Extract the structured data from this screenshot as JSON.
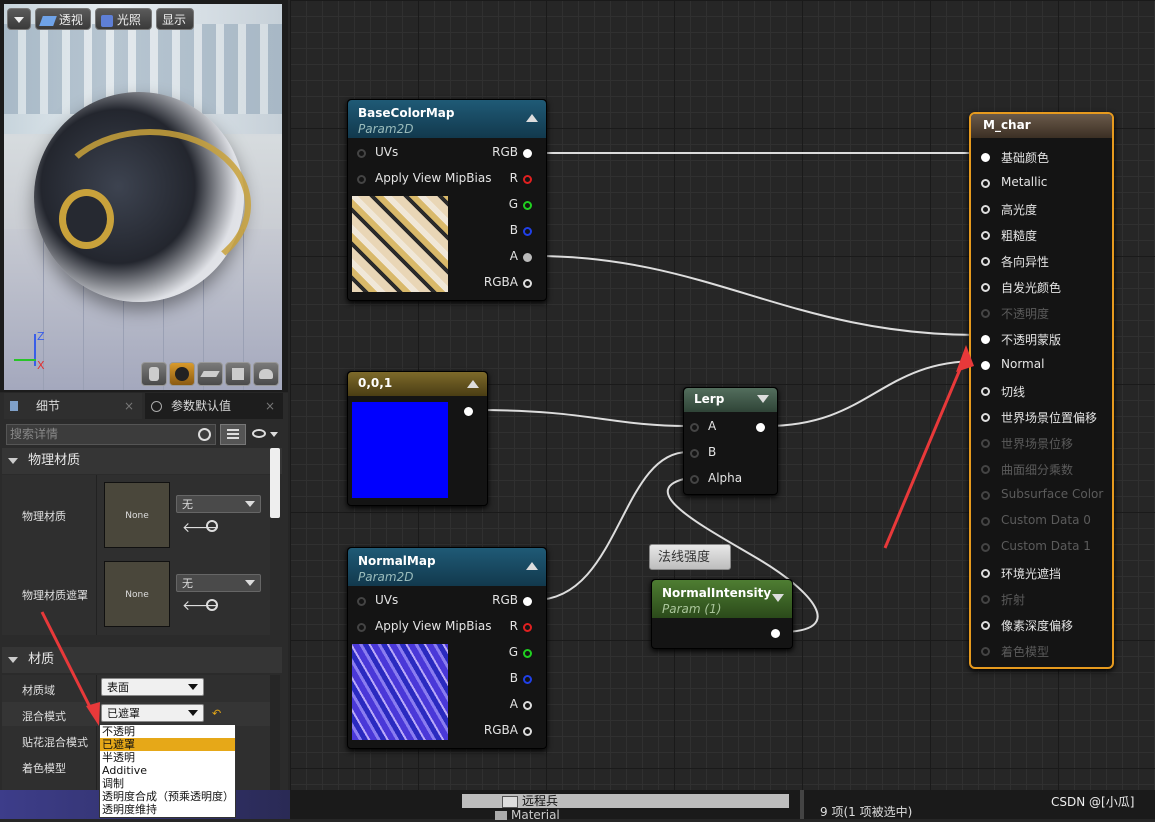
{
  "viewport": {
    "perspective_label": "透视",
    "lit_label": "光照",
    "show_label": "显示"
  },
  "details": {
    "tab_details": "细节",
    "tab_params": "参数默认值",
    "search_placeholder": "搜索详情",
    "physical_section": "物理材质",
    "phys_mat_label": "物理材质",
    "phys_mat_value": "None",
    "phys_mat_combo": "无",
    "phys_mask_label": "物理材质遮罩",
    "phys_mask_value": "None",
    "phys_mask_combo": "无",
    "material_section": "材质",
    "domain_label": "材质域",
    "domain_value": "表面",
    "blend_label": "混合模式",
    "blend_value": "已遮罩",
    "decal_label": "贴花混合模式",
    "shading_label": "着色模型"
  },
  "blend_options": [
    "不透明",
    "已遮罩",
    "半透明",
    "Additive",
    "调制",
    "透明度合成（预乘透明度）",
    "透明度维持"
  ],
  "blend_selected_index": 1,
  "nodes": {
    "basecolor": {
      "title": "BaseColorMap",
      "subtitle": "Param2D",
      "in_uvs": "UVs",
      "in_mip": "Apply View MipBias",
      "out_rgb": "RGB",
      "out_r": "R",
      "out_g": "G",
      "out_b": "B",
      "out_a": "A",
      "out_rgba": "RGBA"
    },
    "constant": {
      "title": "0,0,1"
    },
    "normalmap": {
      "title": "NormalMap",
      "subtitle": "Param2D",
      "in_uvs": "UVs",
      "in_mip": "Apply View MipBias",
      "out_rgb": "RGB",
      "out_r": "R",
      "out_g": "G",
      "out_b": "B",
      "out_a": "A",
      "out_rgba": "RGBA"
    },
    "lerp": {
      "title": "Lerp",
      "in_a": "A",
      "in_b": "B",
      "in_alpha": "Alpha"
    },
    "comment": {
      "text": "法线强度"
    },
    "intensity": {
      "title": "NormalIntensity",
      "subtitle": "Param (1)"
    },
    "output": {
      "title": "M_char",
      "pins": [
        {
          "label": "基础颜色",
          "active": true
        },
        {
          "label": "Metallic",
          "active": true
        },
        {
          "label": "高光度",
          "active": true
        },
        {
          "label": "粗糙度",
          "active": true
        },
        {
          "label": "各向异性",
          "active": true
        },
        {
          "label": "自发光颜色",
          "active": true
        },
        {
          "label": "不透明度",
          "active": false
        },
        {
          "label": "不透明蒙版",
          "active": true
        },
        {
          "label": "Normal",
          "active": true
        },
        {
          "label": "切线",
          "active": true
        },
        {
          "label": "世界场景位置偏移",
          "active": true
        },
        {
          "label": "世界场景位移",
          "active": false
        },
        {
          "label": "曲面细分乘数",
          "active": false
        },
        {
          "label": "Subsurface Color",
          "active": false
        },
        {
          "label": "Custom Data 0",
          "active": false
        },
        {
          "label": "Custom Data 1",
          "active": false
        },
        {
          "label": "环境光遮挡",
          "active": true
        },
        {
          "label": "折射",
          "active": false
        },
        {
          "label": "像素深度偏移",
          "active": true
        },
        {
          "label": "着色模型",
          "active": false
        }
      ]
    }
  },
  "bottom": {
    "folder1": "远程兵",
    "folder2": "Material",
    "status": "9 项(1 项被选中)",
    "watermark": "CSDN @[小瓜]"
  },
  "colors": {
    "accent": "#e6a818",
    "output_border": "#e69a1e",
    "constant_color": "#0000ff",
    "annotation_arrow": "#e8393a"
  }
}
